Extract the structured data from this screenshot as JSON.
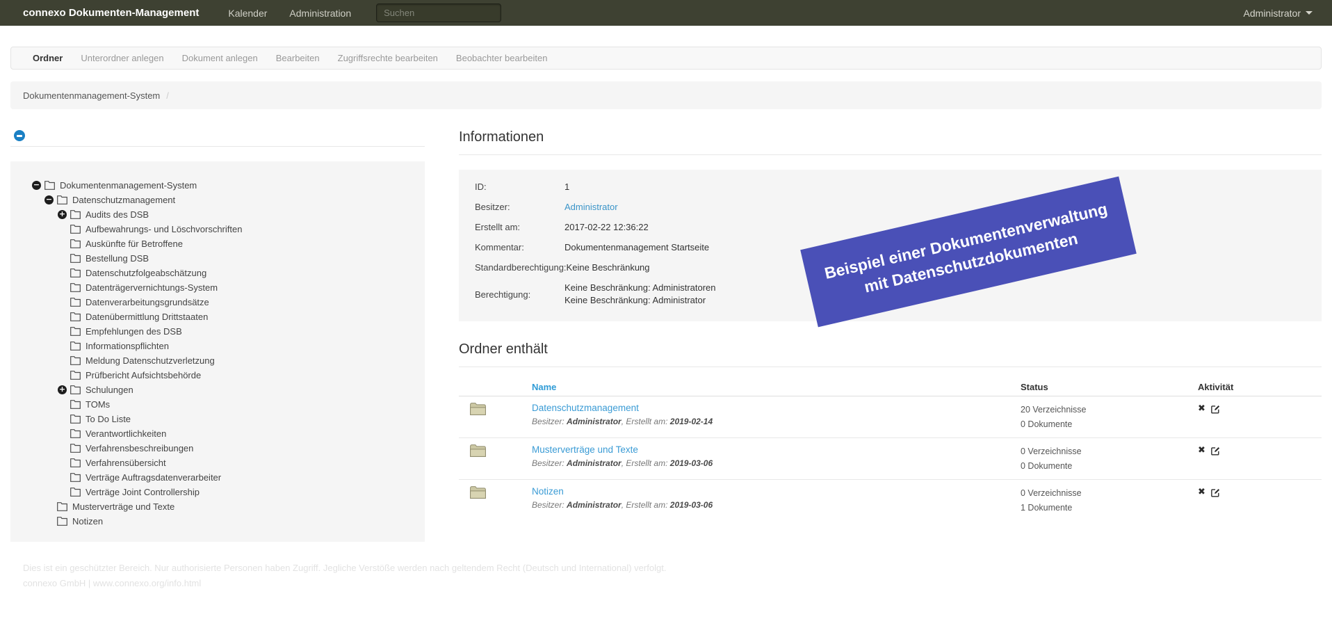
{
  "navbar": {
    "brand": "connexo Dokumenten-Management",
    "links": [
      {
        "label": "Kalender"
      },
      {
        "label": "Administration"
      }
    ],
    "search_placeholder": "Suchen",
    "user_menu": "Administrator"
  },
  "toolbar": {
    "items": [
      {
        "label": "Ordner",
        "state": "active"
      },
      {
        "label": "Unterordner anlegen"
      },
      {
        "label": "Dokument anlegen"
      },
      {
        "label": "Bearbeiten"
      },
      {
        "label": "Zugriffsrechte bearbeiten"
      },
      {
        "label": "Beobachter bearbeiten"
      }
    ]
  },
  "breadcrumb": {
    "current": "Dokumentenmanagement-System",
    "separator": "/"
  },
  "tree": {
    "items": [
      {
        "depth": 0,
        "toggle": "minus",
        "label": "Dokumentenmanagement-System"
      },
      {
        "depth": 1,
        "toggle": "minus",
        "label": "Datenschutzmanagement"
      },
      {
        "depth": 2,
        "toggle": "plus",
        "label": "Audits des DSB"
      },
      {
        "depth": 2,
        "label": "Aufbewahrungs- und Löschvorschriften"
      },
      {
        "depth": 2,
        "label": "Auskünfte für Betroffene"
      },
      {
        "depth": 2,
        "label": "Bestellung DSB"
      },
      {
        "depth": 2,
        "label": "Datenschutzfolgeabschätzung"
      },
      {
        "depth": 2,
        "label": "Datenträgervernichtungs-System"
      },
      {
        "depth": 2,
        "label": "Datenverarbeitungsgrundsätze"
      },
      {
        "depth": 2,
        "label": "Datenübermittlung Drittstaaten"
      },
      {
        "depth": 2,
        "label": "Empfehlungen des DSB"
      },
      {
        "depth": 2,
        "label": "Informationspflichten"
      },
      {
        "depth": 2,
        "label": "Meldung Datenschutzverletzung"
      },
      {
        "depth": 2,
        "label": "Prüfbericht Aufsichtsbehörde"
      },
      {
        "depth": 2,
        "toggle": "plus",
        "label": "Schulungen"
      },
      {
        "depth": 2,
        "label": "TOMs"
      },
      {
        "depth": 2,
        "label": "To Do Liste"
      },
      {
        "depth": 2,
        "label": "Verantwortlichkeiten"
      },
      {
        "depth": 2,
        "label": "Verfahrensbeschreibungen"
      },
      {
        "depth": 2,
        "label": "Verfahrensübersicht"
      },
      {
        "depth": 2,
        "label": "Verträge Auftragsdatenverarbeiter"
      },
      {
        "depth": 2,
        "label": "Verträge Joint Controllership"
      },
      {
        "depth": 1,
        "label": "Musterverträge und Texte"
      },
      {
        "depth": 1,
        "label": "Notizen"
      }
    ]
  },
  "info": {
    "title": "Informationen",
    "id_label": "ID:",
    "id_value": "1",
    "owner_label": "Besitzer:",
    "owner_value": "Administrator",
    "created_label": "Erstellt am:",
    "created_value": "2017-02-22 12:36:22",
    "comment_label": "Kommentar:",
    "comment_value": "Dokumentenmanagement Startseite",
    "default_perm_label": "Standardberechtigung:",
    "default_perm_value": "Keine Beschränkung",
    "perm_label": "Berechtigung:",
    "perm_value_1": "Keine Beschränkung: Administratoren",
    "perm_value_2": "Keine Beschränkung: Administrator"
  },
  "banner": {
    "line1": "Beispiel einer Dokumentenverwaltung",
    "line2": "mit Datenschutzdokumenten",
    "color": "#4a50b7"
  },
  "contents": {
    "title": "Ordner enthält",
    "col_name": "Name",
    "col_status": "Status",
    "col_activity": "Aktivität",
    "delete_icon": "✖",
    "rows": [
      {
        "name": "Datenschutzmanagement",
        "besitzer_label": "Besitzer:",
        "owner": "Administrator",
        "sep": ",",
        "erstellt_label": "Erstellt am:",
        "created": "2019-02-14",
        "dirs": "20 Verzeichnisse",
        "docs": "0 Dokumente"
      },
      {
        "name": "Musterverträge und Texte",
        "besitzer_label": "Besitzer:",
        "owner": "Administrator",
        "sep": ",",
        "erstellt_label": "Erstellt am:",
        "created": "2019-03-06",
        "dirs": "0 Verzeichnisse",
        "docs": "0 Dokumente"
      },
      {
        "name": "Notizen",
        "besitzer_label": "Besitzer:",
        "owner": "Administrator",
        "sep": ",",
        "erstellt_label": "Erstellt am:",
        "created": "2019-03-06",
        "dirs": "0 Verzeichnisse",
        "docs": "1 Dokumente"
      }
    ]
  },
  "footer": {
    "line1": "Dies ist ein geschützter Bereich. Nur authorisierte Personen haben Zugriff. Jegliche Verstöße werden nach geltendem Recht (Deutsch und International) verfolgt.",
    "line2": "connexo GmbH | www.connexo.org/info.html"
  }
}
